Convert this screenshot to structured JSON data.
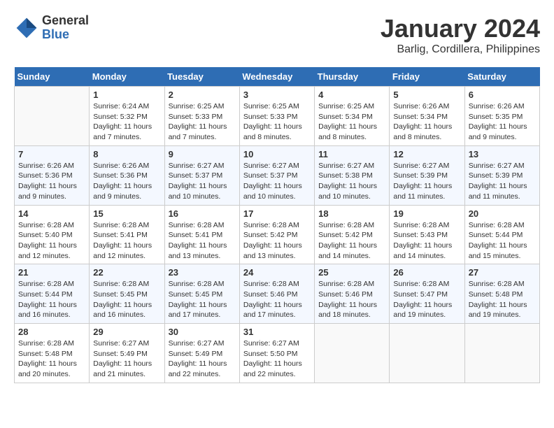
{
  "header": {
    "logo_line1": "General",
    "logo_line2": "Blue",
    "month": "January 2024",
    "location": "Barlig, Cordillera, Philippines"
  },
  "days_of_week": [
    "Sunday",
    "Monday",
    "Tuesday",
    "Wednesday",
    "Thursday",
    "Friday",
    "Saturday"
  ],
  "weeks": [
    [
      {
        "day": "",
        "sunrise": "",
        "sunset": "",
        "daylight": ""
      },
      {
        "day": "1",
        "sunrise": "Sunrise: 6:24 AM",
        "sunset": "Sunset: 5:32 PM",
        "daylight": "Daylight: 11 hours and 7 minutes."
      },
      {
        "day": "2",
        "sunrise": "Sunrise: 6:25 AM",
        "sunset": "Sunset: 5:33 PM",
        "daylight": "Daylight: 11 hours and 7 minutes."
      },
      {
        "day": "3",
        "sunrise": "Sunrise: 6:25 AM",
        "sunset": "Sunset: 5:33 PM",
        "daylight": "Daylight: 11 hours and 8 minutes."
      },
      {
        "day": "4",
        "sunrise": "Sunrise: 6:25 AM",
        "sunset": "Sunset: 5:34 PM",
        "daylight": "Daylight: 11 hours and 8 minutes."
      },
      {
        "day": "5",
        "sunrise": "Sunrise: 6:26 AM",
        "sunset": "Sunset: 5:34 PM",
        "daylight": "Daylight: 11 hours and 8 minutes."
      },
      {
        "day": "6",
        "sunrise": "Sunrise: 6:26 AM",
        "sunset": "Sunset: 5:35 PM",
        "daylight": "Daylight: 11 hours and 9 minutes."
      }
    ],
    [
      {
        "day": "7",
        "sunrise": "Sunrise: 6:26 AM",
        "sunset": "Sunset: 5:36 PM",
        "daylight": "Daylight: 11 hours and 9 minutes."
      },
      {
        "day": "8",
        "sunrise": "Sunrise: 6:26 AM",
        "sunset": "Sunset: 5:36 PM",
        "daylight": "Daylight: 11 hours and 9 minutes."
      },
      {
        "day": "9",
        "sunrise": "Sunrise: 6:27 AM",
        "sunset": "Sunset: 5:37 PM",
        "daylight": "Daylight: 11 hours and 10 minutes."
      },
      {
        "day": "10",
        "sunrise": "Sunrise: 6:27 AM",
        "sunset": "Sunset: 5:37 PM",
        "daylight": "Daylight: 11 hours and 10 minutes."
      },
      {
        "day": "11",
        "sunrise": "Sunrise: 6:27 AM",
        "sunset": "Sunset: 5:38 PM",
        "daylight": "Daylight: 11 hours and 10 minutes."
      },
      {
        "day": "12",
        "sunrise": "Sunrise: 6:27 AM",
        "sunset": "Sunset: 5:39 PM",
        "daylight": "Daylight: 11 hours and 11 minutes."
      },
      {
        "day": "13",
        "sunrise": "Sunrise: 6:27 AM",
        "sunset": "Sunset: 5:39 PM",
        "daylight": "Daylight: 11 hours and 11 minutes."
      }
    ],
    [
      {
        "day": "14",
        "sunrise": "Sunrise: 6:28 AM",
        "sunset": "Sunset: 5:40 PM",
        "daylight": "Daylight: 11 hours and 12 minutes."
      },
      {
        "day": "15",
        "sunrise": "Sunrise: 6:28 AM",
        "sunset": "Sunset: 5:41 PM",
        "daylight": "Daylight: 11 hours and 12 minutes."
      },
      {
        "day": "16",
        "sunrise": "Sunrise: 6:28 AM",
        "sunset": "Sunset: 5:41 PM",
        "daylight": "Daylight: 11 hours and 13 minutes."
      },
      {
        "day": "17",
        "sunrise": "Sunrise: 6:28 AM",
        "sunset": "Sunset: 5:42 PM",
        "daylight": "Daylight: 11 hours and 13 minutes."
      },
      {
        "day": "18",
        "sunrise": "Sunrise: 6:28 AM",
        "sunset": "Sunset: 5:42 PM",
        "daylight": "Daylight: 11 hours and 14 minutes."
      },
      {
        "day": "19",
        "sunrise": "Sunrise: 6:28 AM",
        "sunset": "Sunset: 5:43 PM",
        "daylight": "Daylight: 11 hours and 14 minutes."
      },
      {
        "day": "20",
        "sunrise": "Sunrise: 6:28 AM",
        "sunset": "Sunset: 5:44 PM",
        "daylight": "Daylight: 11 hours and 15 minutes."
      }
    ],
    [
      {
        "day": "21",
        "sunrise": "Sunrise: 6:28 AM",
        "sunset": "Sunset: 5:44 PM",
        "daylight": "Daylight: 11 hours and 16 minutes."
      },
      {
        "day": "22",
        "sunrise": "Sunrise: 6:28 AM",
        "sunset": "Sunset: 5:45 PM",
        "daylight": "Daylight: 11 hours and 16 minutes."
      },
      {
        "day": "23",
        "sunrise": "Sunrise: 6:28 AM",
        "sunset": "Sunset: 5:45 PM",
        "daylight": "Daylight: 11 hours and 17 minutes."
      },
      {
        "day": "24",
        "sunrise": "Sunrise: 6:28 AM",
        "sunset": "Sunset: 5:46 PM",
        "daylight": "Daylight: 11 hours and 17 minutes."
      },
      {
        "day": "25",
        "sunrise": "Sunrise: 6:28 AM",
        "sunset": "Sunset: 5:46 PM",
        "daylight": "Daylight: 11 hours and 18 minutes."
      },
      {
        "day": "26",
        "sunrise": "Sunrise: 6:28 AM",
        "sunset": "Sunset: 5:47 PM",
        "daylight": "Daylight: 11 hours and 19 minutes."
      },
      {
        "day": "27",
        "sunrise": "Sunrise: 6:28 AM",
        "sunset": "Sunset: 5:48 PM",
        "daylight": "Daylight: 11 hours and 19 minutes."
      }
    ],
    [
      {
        "day": "28",
        "sunrise": "Sunrise: 6:28 AM",
        "sunset": "Sunset: 5:48 PM",
        "daylight": "Daylight: 11 hours and 20 minutes."
      },
      {
        "day": "29",
        "sunrise": "Sunrise: 6:27 AM",
        "sunset": "Sunset: 5:49 PM",
        "daylight": "Daylight: 11 hours and 21 minutes."
      },
      {
        "day": "30",
        "sunrise": "Sunrise: 6:27 AM",
        "sunset": "Sunset: 5:49 PM",
        "daylight": "Daylight: 11 hours and 22 minutes."
      },
      {
        "day": "31",
        "sunrise": "Sunrise: 6:27 AM",
        "sunset": "Sunset: 5:50 PM",
        "daylight": "Daylight: 11 hours and 22 minutes."
      },
      {
        "day": "",
        "sunrise": "",
        "sunset": "",
        "daylight": ""
      },
      {
        "day": "",
        "sunrise": "",
        "sunset": "",
        "daylight": ""
      },
      {
        "day": "",
        "sunrise": "",
        "sunset": "",
        "daylight": ""
      }
    ]
  ]
}
